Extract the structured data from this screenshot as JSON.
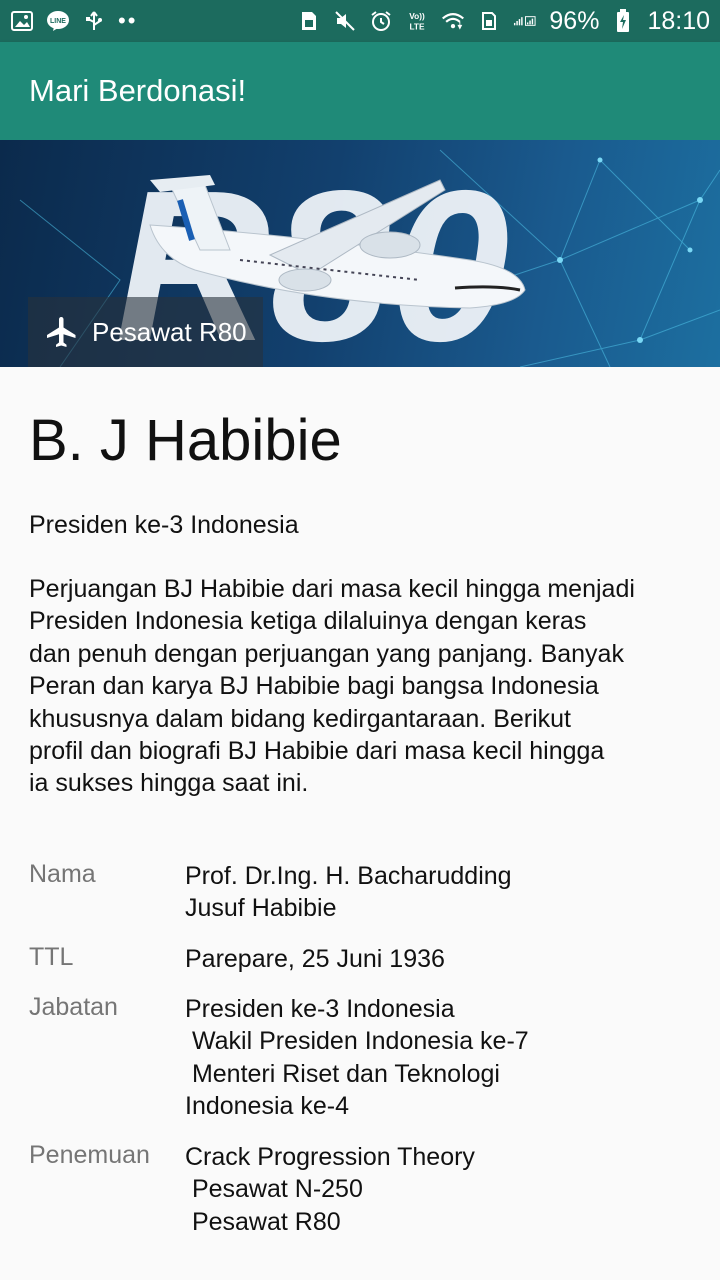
{
  "status_bar": {
    "battery": "96%",
    "time": "18:10",
    "icons": [
      "image-icon",
      "line-icon",
      "usb-icon",
      "more-dots",
      "sim-icon",
      "mute-icon",
      "alarm-icon",
      "volte-icon",
      "wifi-icon",
      "signal-icon",
      "battery-icon"
    ]
  },
  "app_bar": {
    "title": "Mari Berdonasi!"
  },
  "hero": {
    "caption": "Pesawat R80",
    "brand_text": "R80"
  },
  "profile": {
    "name": "B. J Habibie",
    "subtitle": "Presiden ke-3 Indonesia",
    "description_lines": [
      "Perjuangan BJ Habibie dari masa kecil hingga menjadi",
      "Presiden Indonesia ketiga dilaluinya dengan keras",
      "dan penuh dengan perjuangan yang panjang. Banyak",
      "Peran dan karya BJ Habibie bagi bangsa Indonesia",
      "khususnya dalam bidang kedirgantaraan. Berikut",
      "profil dan biografi BJ Habibie dari masa kecil hingga",
      "ia sukses hingga saat ini."
    ]
  },
  "info": [
    {
      "label": "Nama",
      "values": [
        "Prof. Dr.Ing. H. Bacharudding",
        "Jusuf Habibie"
      ]
    },
    {
      "label": "TTL",
      "values": [
        "Parepare, 25 Juni 1936"
      ]
    },
    {
      "label": "Jabatan",
      "values": [
        "Presiden ke-3 Indonesia",
        " Wakil Presiden Indonesia ke-7",
        " Menteri Riset dan Teknologi",
        "Indonesia ke-4"
      ]
    },
    {
      "label": "Penemuan",
      "values": [
        "Crack Progression Theory",
        " Pesawat N-250",
        " Pesawat R80"
      ]
    }
  ]
}
